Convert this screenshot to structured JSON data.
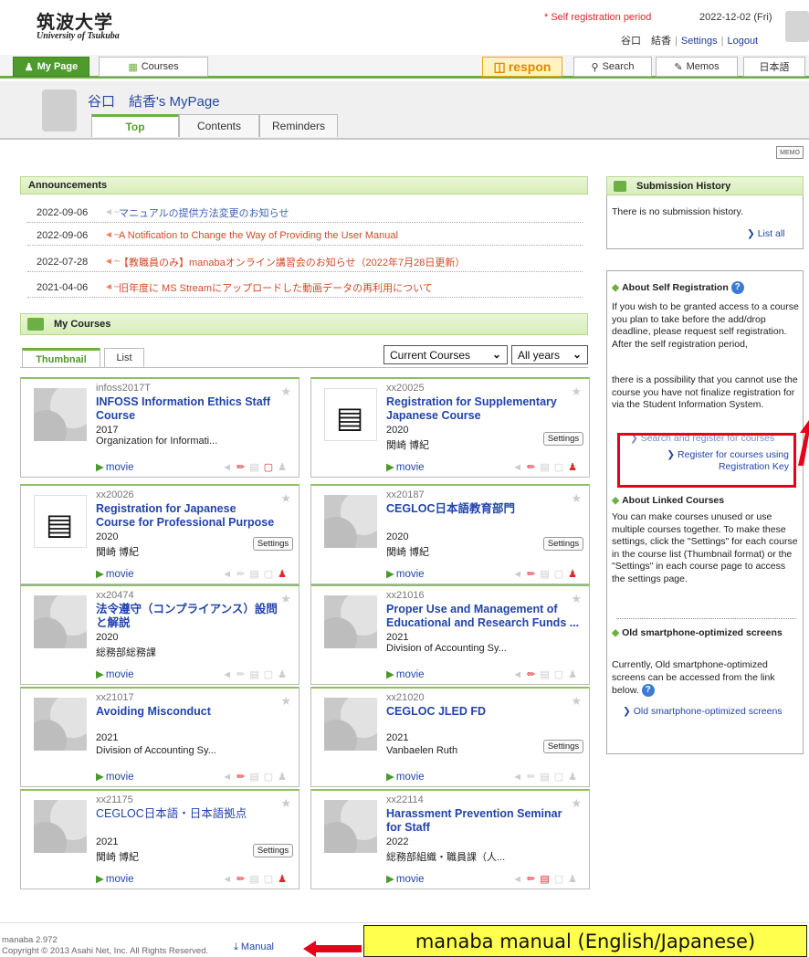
{
  "header": {
    "logo_main": "筑波大学",
    "logo_sub": "University of Tsukuba",
    "self_registration": "* Self registration period",
    "date": "2022-12-02 (Fri)",
    "user_name": "谷口　結香",
    "settings_link": "Settings",
    "logout_link": "Logout"
  },
  "nav": {
    "mypage": "My Page",
    "courses": "Courses",
    "respon": "respon",
    "search": "Search",
    "memos": "Memos",
    "language": "日本語"
  },
  "mypage": {
    "title": "谷口　結香's MyPage",
    "tabs": [
      "Top",
      "Contents",
      "Reminders"
    ],
    "memo_label": "MEMO"
  },
  "announcements": {
    "title": "Announcements",
    "items": [
      {
        "date": "2022-09-06",
        "text": "マニュアルの提供方法変更のお知らせ"
      },
      {
        "date": "2022-09-06",
        "text": "A Notification to Change the Way of Providing the User Manual"
      },
      {
        "date": "2022-07-28",
        "text": "【教職員のみ】manabaオンライン講習会のお知らせ（2022年7月28日更新）"
      },
      {
        "date": "2021-04-06",
        "text": "旧年度に MS Streamにアップロードした動画データの再利用について"
      }
    ]
  },
  "my_courses": {
    "title": "My Courses",
    "view_tabs": [
      "Thumbnail",
      "List"
    ],
    "filter_current": "Current Courses",
    "filter_years": "All years",
    "movie_label": "movie",
    "settings_label": "Settings",
    "courses": [
      {
        "code": "infoss2017T",
        "title": "INFOSS Information Ethics Staff Course",
        "year": "2017",
        "org": "Organization for Informati..."
      },
      {
        "code": "xx20025",
        "title": "Registration for Supplementary Japanese Course",
        "year": "2020",
        "org": "関崎 博紀"
      },
      {
        "code": "xx20026",
        "title": "Registration for Japanese Course for Professional Purpose",
        "year": "2020",
        "org": "関崎 博紀"
      },
      {
        "code": "xx20187",
        "title": "CEGLOC日本語教育部門",
        "year": "2020",
        "org": "関崎 博紀"
      },
      {
        "code": "xx20474",
        "title": "法令遵守（コンプライアンス）設問と解説",
        "year": "2020",
        "org": "総務部総務課"
      },
      {
        "code": "xx21016",
        "title": "Proper Use and Management of Educational and Research Funds ...",
        "year": "2021",
        "org": "Division of Accounting Sy..."
      },
      {
        "code": "xx21017",
        "title": "Avoiding Misconduct",
        "year": "2021",
        "org": "Division of Accounting Sy..."
      },
      {
        "code": "xx21020",
        "title": "CEGLOC JLED FD",
        "year": "2021",
        "org": "Vanbaelen Ruth"
      },
      {
        "code": "xx21175",
        "title": "CEGLOC日本語・日本語拠点",
        "year": "2021",
        "org": "関崎 博紀"
      },
      {
        "code": "xx22114",
        "title": "Harassment Prevention Seminar for Staff",
        "year": "2022",
        "org": "総務部組織・職員課（人..."
      }
    ]
  },
  "submission": {
    "title": "Submission History",
    "empty_text": "There is no submission history.",
    "list_all": "List all"
  },
  "help": {
    "self_reg_title": "About Self Registration",
    "self_reg_text": "If you wish to be granted access to a course you plan to take before the add/drop deadline, please request self registration. After the self registration period,",
    "self_reg_text2": "there is a possibility that you cannot use the course you have not finalize registration for via the Student Information System.",
    "search_link": "Search and register for courses",
    "key_link": "Register for courses using Registration Key",
    "linked_title": "About Linked Courses",
    "linked_text": "You can make courses unused or use multiple courses together. To make these settings, click the \"Settings\" for each course in the course list (Thumbnail format) or the \"Settings\" in each course page to access the settings page.",
    "smartphone_title": "Old smartphone-optimized screens",
    "smartphone_text": "Currently, Old smartphone-optimized screens can be accessed from the link below.",
    "smartphone_link": "Old smartphone-optimized screens"
  },
  "footer": {
    "version": "manaba 2.972",
    "copyright": "Copyright © 2013 Asahi Net, Inc. All Rights Reserved.",
    "manual": "Manual"
  },
  "annotation": {
    "manual_callout": "manaba manual (English/Japanese)"
  },
  "colors": {
    "accent_green": "#6cb043",
    "link_blue": "#2244aa",
    "alert_red": "#e0262a",
    "callout_yellow": "#ffff4d"
  }
}
